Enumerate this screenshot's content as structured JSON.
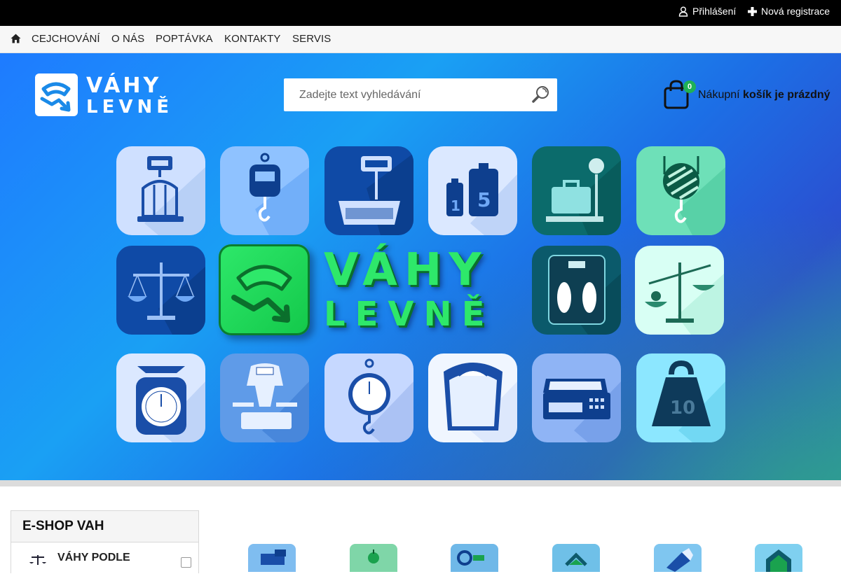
{
  "topbar": {
    "login_label": "Přihlášení",
    "register_label": "Nová registrace"
  },
  "nav": {
    "items": [
      "CEJCHOVÁNÍ",
      "O NÁS",
      "POPTÁVKA",
      "KONTAKTY",
      "SERVIS"
    ]
  },
  "header": {
    "logo_line1": "VÁHY",
    "logo_line2": "LEVNĚ",
    "search_placeholder": "Zadejte text vyhledávání",
    "cart_count": "0",
    "cart_text_normal": "Nákupní",
    "cart_text_bold": "košík je prázdný"
  },
  "hero": {
    "brand_line1": "VÁHY",
    "brand_line2": "LEVNĚ",
    "tile_icons": [
      "platform-scale-icon",
      "hanging-scale-icon",
      "counter-scale-icon",
      "weights-1-5-icon",
      "luggage-scale-icon",
      "crane-scale-icon",
      "balance-scale-icon",
      "bathroom-scale-icon",
      "pharmacy-balance-icon",
      "kitchen-scale-icon",
      "analog-shop-scale-icon",
      "spring-scale-icon",
      "mechanical-bathroom-scale-icon",
      "retail-scale-icon",
      "kettlebell-10-icon"
    ],
    "kettlebell_label": "10",
    "weight_labels": [
      "1",
      "5"
    ]
  },
  "sidebar": {
    "title": "E-SHOP VAH",
    "first_item": "VÁHY PODLE"
  },
  "colors": {
    "accent_green": "#1fb156",
    "brand_green": "#2ee86a",
    "hero_blue": "#1e7bff"
  }
}
